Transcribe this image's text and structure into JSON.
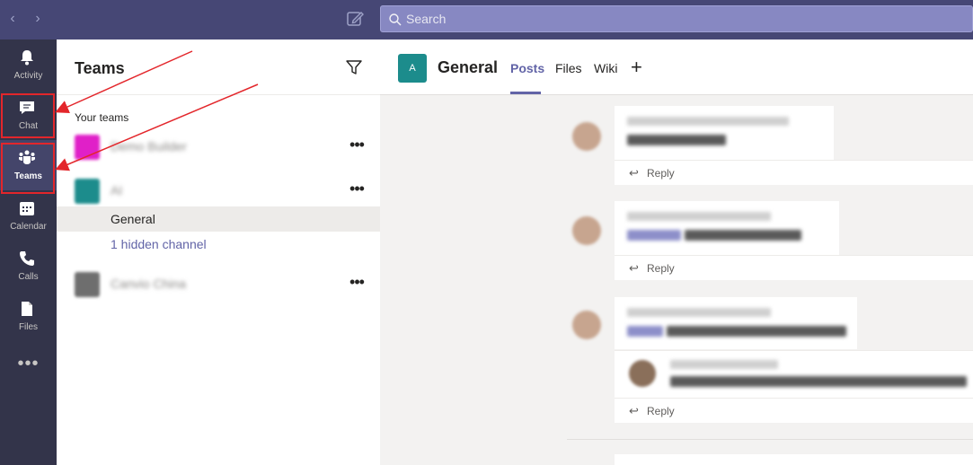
{
  "search": {
    "placeholder": "Search"
  },
  "rail": {
    "items": [
      {
        "label": "Activity",
        "icon": "bell-icon"
      },
      {
        "label": "Chat",
        "icon": "chat-icon"
      },
      {
        "label": "Teams",
        "icon": "teams-icon"
      },
      {
        "label": "Calendar",
        "icon": "calendar-icon"
      },
      {
        "label": "Calls",
        "icon": "phone-icon"
      },
      {
        "label": "Files",
        "icon": "file-icon"
      }
    ],
    "more": "•••"
  },
  "teams_pane": {
    "title": "Teams",
    "section_label": "Your teams",
    "teams": [
      {
        "name": "Demo Builder",
        "color": "#e020c8",
        "more": "•••"
      },
      {
        "name": "AI",
        "color": "#1c8c8c",
        "more": "•••"
      },
      {
        "name": "Canvio China",
        "color": "#6e6e6e",
        "more": "•••"
      }
    ],
    "channels": {
      "selected": "General",
      "hidden": "1 hidden channel"
    }
  },
  "channel": {
    "avatar_letter": "A",
    "title": "General",
    "tabs": [
      "Posts",
      "Files",
      "Wiki"
    ],
    "active_tab": "Posts",
    "add_tab": "+"
  },
  "posts": {
    "reply_label": "Reply",
    "reply_icon": "↩"
  },
  "colors": {
    "brand": "#6264a7",
    "topbar": "#464775",
    "rail": "#33344a",
    "annotation": "#e3262b"
  }
}
